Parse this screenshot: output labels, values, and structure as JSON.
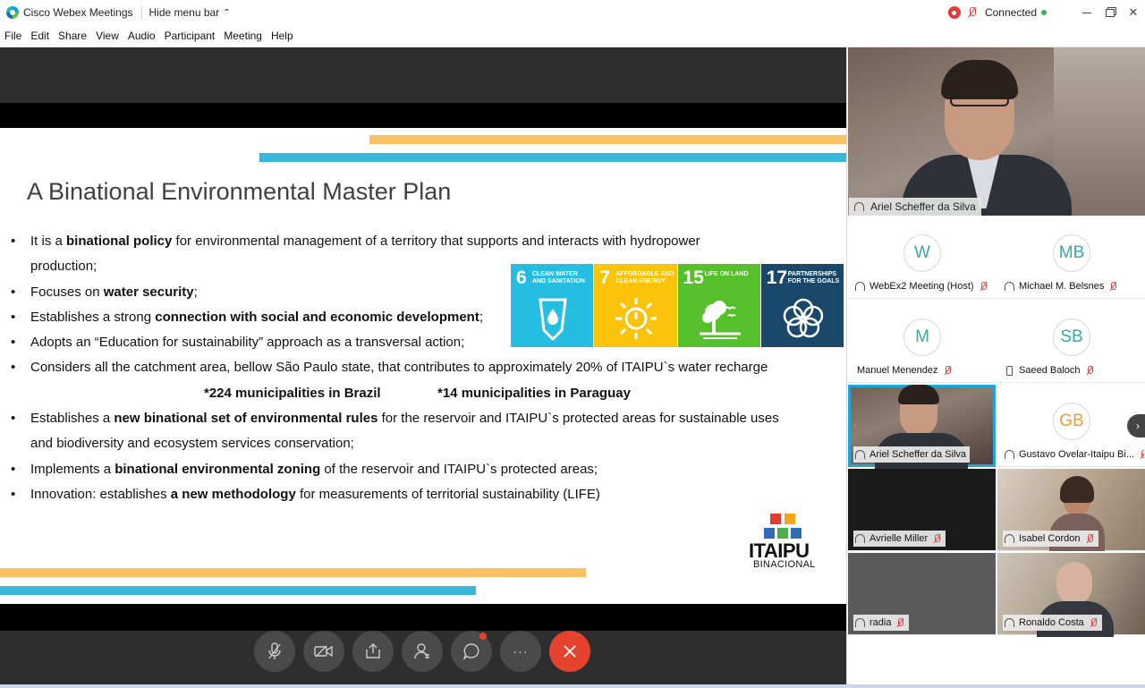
{
  "titlebar": {
    "app_title": "Cisco Webex Meetings",
    "hide_menu": "Hide menu bar",
    "connected": "Connected"
  },
  "menu": [
    "File",
    "Edit",
    "Share",
    "View",
    "Audio",
    "Participant",
    "Meeting",
    "Help"
  ],
  "slide": {
    "title": "A Binational Environmental Master Plan",
    "bullets": [
      {
        "pre": "It is a ",
        "bold": "binational policy",
        "post": " for environmental management of a territory that supports and interacts with hydropower"
      },
      {
        "pre": "production;",
        "bold": "",
        "post": ""
      },
      {
        "pre": "Focuses on ",
        "bold": "water security",
        "post": ";"
      },
      {
        "pre": "Establishes a strong ",
        "bold": "connection with social and economic development",
        "post": ";"
      },
      {
        "pre": "Adopts an “Education for sustainability” approach as a transversal action;",
        "bold": "",
        "post": ""
      },
      {
        "pre": "Considers all the catchment area, bellow São Paulo state, that contributes to approximately 20% of ITAIPU`s water recharge",
        "bold": "",
        "post": ""
      },
      {
        "pre": "Establishes a ",
        "bold": "new binational set of environmental rules",
        "post": " for the reservoir and ITAIPU`s protected areas for sustainable uses"
      },
      {
        "pre": "and biodiversity and ecosystem services conservation;",
        "bold": "",
        "post": ""
      },
      {
        "pre": "Implements a ",
        "bold": "binational environmental zoning",
        "post": " of the reservoir and ITAIPU`s protected areas;"
      },
      {
        "pre": "Innovation: establishes ",
        "bold": "a new methodology",
        "post": " for measurements of territorial sustainability (LIFE)"
      }
    ],
    "municipalities_brazil": "*224 municipalities in Brazil",
    "municipalities_paraguay": "*14 municipalities in Paraguay",
    "sdg": [
      {
        "num": "6",
        "label": "CLEAN WATER AND SANITATION",
        "color": "#26bde2"
      },
      {
        "num": "7",
        "label": "AFFORDABLE AND CLEAN ENERGY",
        "color": "#fcc30b"
      },
      {
        "num": "15",
        "label": "LIFE ON LAND",
        "color": "#56c02b"
      },
      {
        "num": "17",
        "label": "PARTNERSHIPS FOR THE GOALS",
        "color": "#19486a"
      }
    ],
    "logo": {
      "name": "ITAIPU",
      "sub": "BINACIONAL"
    }
  },
  "controls": {
    "more": "···"
  },
  "active_speaker": {
    "name": "Ariel Scheffer da Silva"
  },
  "participants": [
    {
      "initials": "W",
      "name": "WebEx2 Meeting (Host)",
      "initials_color": "#3aa9a1"
    },
    {
      "initials": "MB",
      "name": "Michael M. Belsnes",
      "initials_color": "#3aa9a1"
    },
    {
      "initials": "M",
      "name": "Manuel Menendez",
      "initials_color": "#3aa9a1"
    },
    {
      "initials": "SB",
      "name": "Saeed Baloch",
      "initials_color": "#3aa9a1"
    },
    {
      "initials": "",
      "name": "Ariel Scheffer da Silva",
      "initials_color": ""
    },
    {
      "initials": "GB",
      "name": "Gustavo Ovelar-Itaipu Bi...",
      "initials_color": "#e8a13a"
    },
    {
      "initials": "",
      "name": "Avrielle Miller",
      "initials_color": ""
    },
    {
      "initials": "",
      "name": "Isabel Cordon",
      "initials_color": ""
    },
    {
      "initials": "",
      "name": "radia",
      "initials_color": ""
    },
    {
      "initials": "",
      "name": "Ronaldo Costa",
      "initials_color": ""
    }
  ],
  "colors": {
    "accent": "#1fa5d8",
    "end_call": "#e5432f",
    "slide_orange": "#fbc064",
    "slide_blue": "#39b7d9"
  }
}
